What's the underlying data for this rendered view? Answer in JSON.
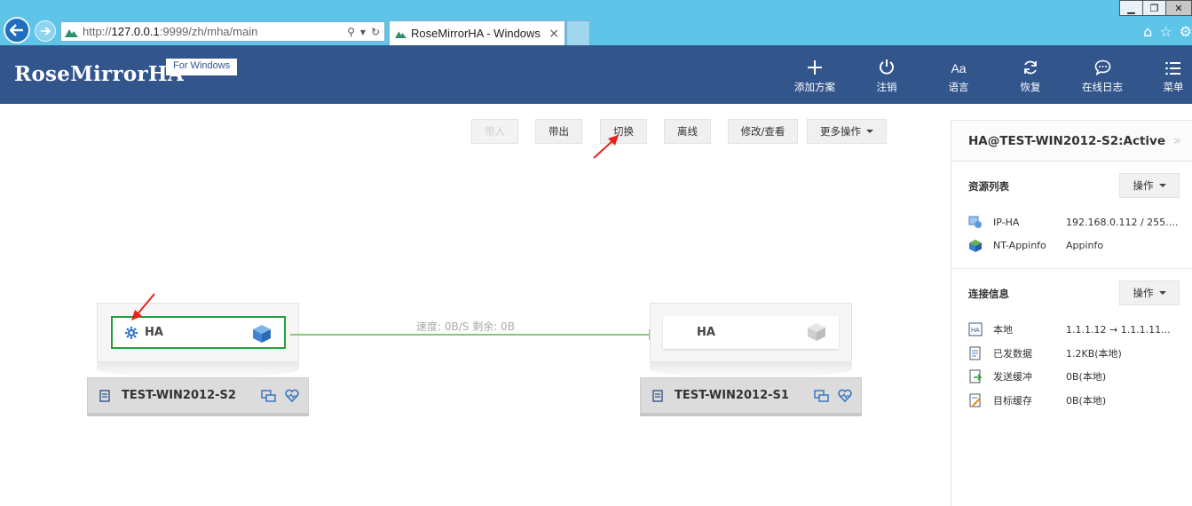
{
  "browser": {
    "url_prefix": "http://",
    "url_host": "127.0.0.1",
    "url_path": ":9999/zh/mha/main",
    "tab_title": "RoseMirrorHA - Windows",
    "tab_close": "×"
  },
  "header": {
    "logo": "RoseMirrorHA",
    "edition": "For Windows",
    "nav": [
      {
        "label": "添加方案",
        "icon": "plus-icon"
      },
      {
        "label": "注销",
        "icon": "power-icon"
      },
      {
        "label": "语言",
        "icon": "language-icon"
      },
      {
        "label": "恢复",
        "icon": "refresh-icon"
      },
      {
        "label": "在线日志",
        "icon": "chat-log-icon"
      },
      {
        "label": "菜单",
        "icon": "menu-list-icon"
      }
    ]
  },
  "toolbar": {
    "import": "带入",
    "export": "带出",
    "switch": "切换",
    "offline": "离线",
    "modify": "修改/查看",
    "more": "更多操作"
  },
  "topology": {
    "left_host": {
      "name": "TEST-WIN2012-S2",
      "rg_label": "HA"
    },
    "right_host": {
      "name": "TEST-WIN2012-S1",
      "rg_label": "HA"
    },
    "link_status": "速度: 0B/S 剩余: 0B"
  },
  "panel": {
    "title": "HA@TEST-WIN2012-S2:Active",
    "resources": {
      "heading": "资源列表",
      "op_button": "操作",
      "items": [
        {
          "key": "IP-HA",
          "value": "192.168.0.112 / 255.255.2...",
          "icon": "ip-resource-icon"
        },
        {
          "key": "NT-Appinfo",
          "value": "Appinfo",
          "icon": "service-resource-icon"
        }
      ]
    },
    "connection": {
      "heading": "连接信息",
      "op_button": "操作",
      "items": [
        {
          "key": "本地",
          "value": "1.1.1.12 → 1.1.1.11...",
          "icon": "local-link-icon"
        },
        {
          "key": "已发数据",
          "value": "1.2KB(本地)",
          "icon": "sent-data-icon"
        },
        {
          "key": "发送缓冲",
          "value": "0B(本地)",
          "icon": "send-buffer-icon"
        },
        {
          "key": "目标缓存",
          "value": "0B(本地)",
          "icon": "target-cache-icon"
        }
      ]
    }
  },
  "colors": {
    "header_bg": "#32558c",
    "browser_bg": "#5ec5e9",
    "link_green": "#86c879",
    "selected_border": "#1ea13a",
    "annotation_red": "#e8231c"
  }
}
